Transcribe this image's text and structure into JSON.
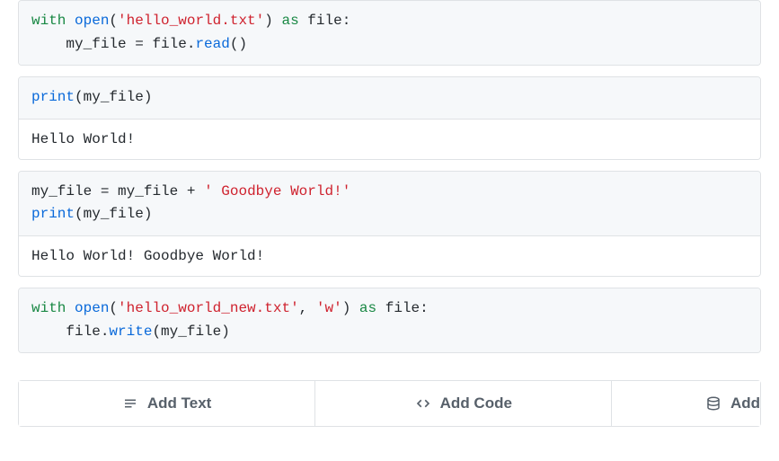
{
  "cells": [
    {
      "code": {
        "kw1": "with",
        "builtin_open": "open",
        "p_open": "(",
        "str1": "'hello_world.txt'",
        "p_close": ")",
        "kw2": "as",
        "var_file": "file",
        "colon": ":",
        "indent": "    ",
        "var_myfile": "my_file",
        "eq": " = ",
        "file2": "file",
        "dot": ".",
        "read": "read",
        "parens": "()"
      }
    },
    {
      "code": {
        "print": "print",
        "p_open": "(",
        "arg": "my_file",
        "p_close": ")"
      },
      "output": "Hello World!"
    },
    {
      "code": {
        "var": "my_file",
        "eq": " = ",
        "var2": "my_file",
        "plus": " + ",
        "str": "' Goodbye World!'",
        "print": "print",
        "p_open": "(",
        "arg": "my_file",
        "p_close": ")"
      },
      "output": "Hello World! Goodbye World!"
    },
    {
      "code": {
        "kw1": "with",
        "builtin_open": "open",
        "p_open": "(",
        "str1": "'hello_world_new.txt'",
        "comma": ", ",
        "str2": "'w'",
        "p_close": ")",
        "kw2": "as",
        "var_file": "file",
        "colon": ":",
        "indent": "    ",
        "file2": "file",
        "dot": ".",
        "write": "write",
        "p_open2": "(",
        "arg": "my_file",
        "p_close2": ")"
      }
    }
  ],
  "toolbar": {
    "add_text": "Add Text",
    "add_code": "Add Code",
    "add_data": "Add"
  }
}
